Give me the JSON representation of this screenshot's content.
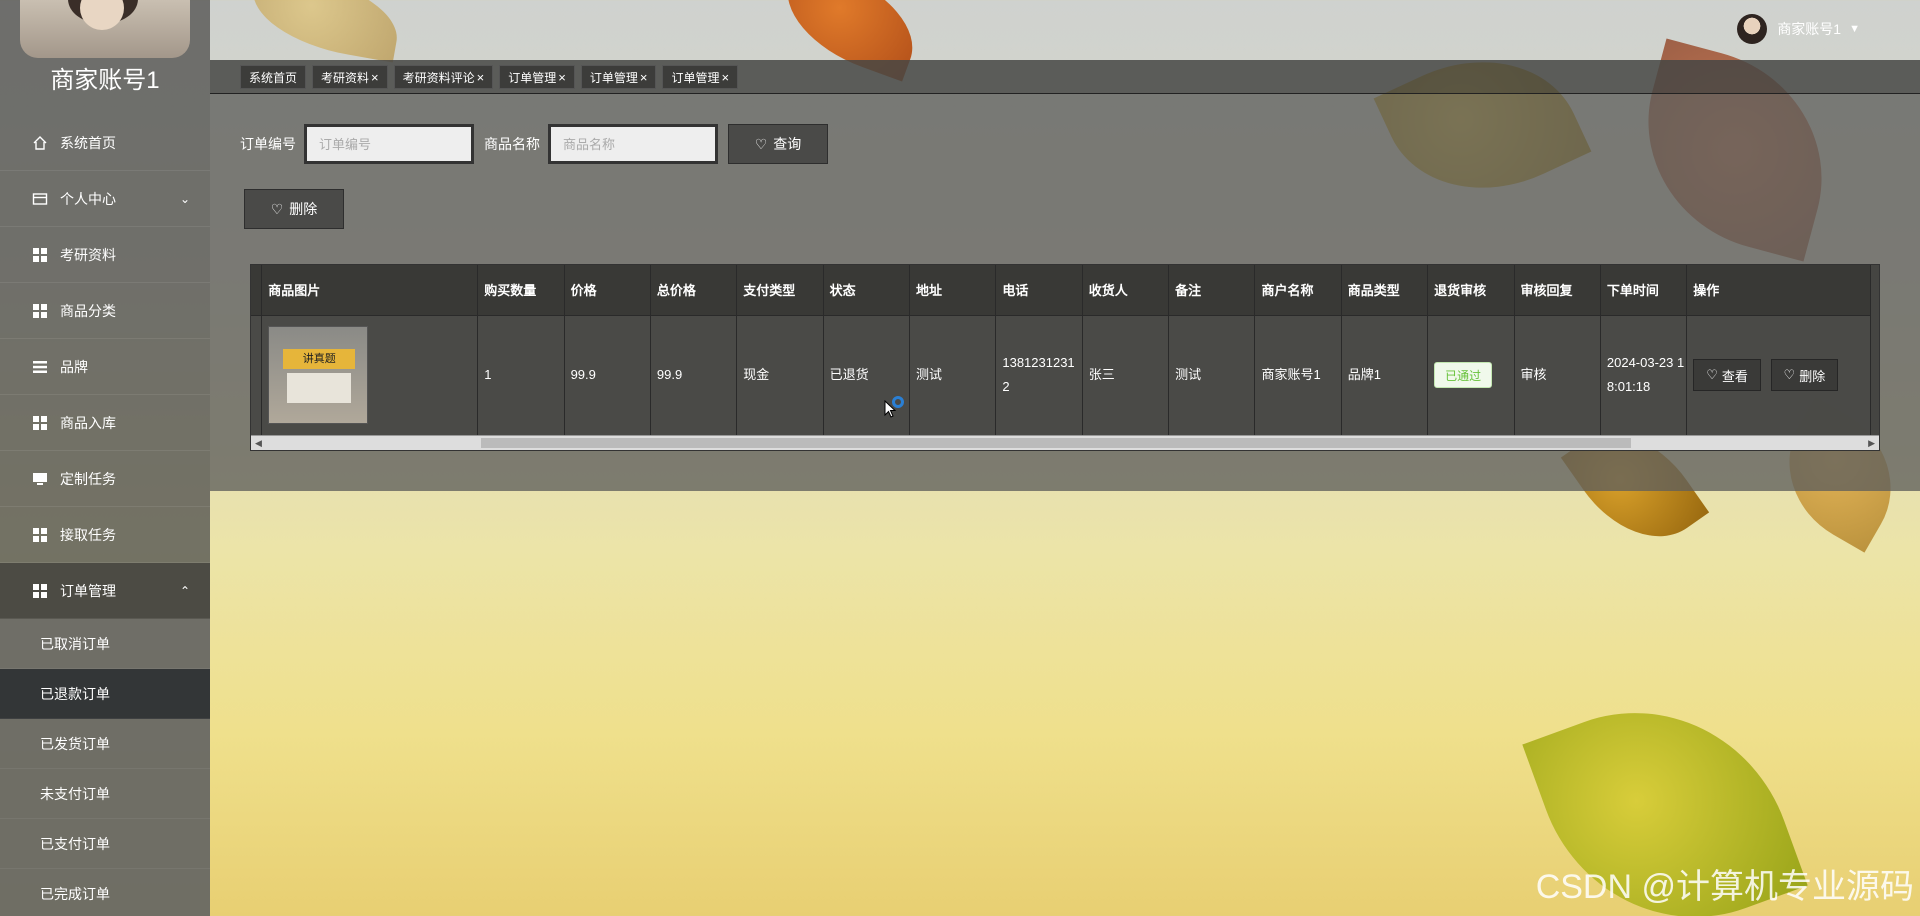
{
  "sidebar": {
    "title": "商家账号1",
    "items": [
      {
        "label": "系统首页",
        "icon": "home-icon"
      },
      {
        "label": "个人中心",
        "icon": "card-icon",
        "arrow": "chevron-down"
      },
      {
        "label": "考研资料",
        "icon": "grid-icon"
      },
      {
        "label": "商品分类",
        "icon": "grid-icon"
      },
      {
        "label": "品牌",
        "icon": "list-icon"
      },
      {
        "label": "商品入库",
        "icon": "grid-icon"
      },
      {
        "label": "定制任务",
        "icon": "monitor-icon"
      },
      {
        "label": "接取任务",
        "icon": "grid-icon"
      },
      {
        "label": "订单管理",
        "icon": "grid-icon",
        "arrow": "chevron-up"
      }
    ],
    "submenu": [
      "已取消订单",
      "已退款订单",
      "已发货订单",
      "未支付订单",
      "已支付订单",
      "已完成订单"
    ],
    "active_submenu": "已退款订单"
  },
  "header": {
    "username": "商家账号1"
  },
  "tabs": [
    {
      "label": "系统首页",
      "closable": false
    },
    {
      "label": "考研资料",
      "closable": true
    },
    {
      "label": "考研资料评论",
      "closable": true
    },
    {
      "label": "订单管理",
      "closable": true
    },
    {
      "label": "订单管理",
      "closable": true
    },
    {
      "label": "订单管理",
      "closable": true
    }
  ],
  "search": {
    "order_no_label": "订单编号",
    "order_no_placeholder": "订单编号",
    "product_name_label": "商品名称",
    "product_name_placeholder": "商品名称",
    "query_button": "查询",
    "delete_button": "删除"
  },
  "table": {
    "columns": [
      "商品图片",
      "购买数量",
      "价格",
      "总价格",
      "支付类型",
      "状态",
      "地址",
      "电话",
      "收货人",
      "备注",
      "商户名称",
      "商品类型",
      "退货审核",
      "审核回复",
      "下单时间",
      "操作"
    ],
    "rows": [
      {
        "image_text": "讲真题",
        "quantity": "1",
        "price": "99.9",
        "total": "99.9",
        "pay_type": "现金",
        "status": "已退货",
        "address": "测试",
        "phone": "13812312312",
        "receiver": "张三",
        "remark": "测试",
        "merchant": "商家账号1",
        "product_type": "品牌1",
        "return_review": "已通过",
        "review_reply": "审核",
        "order_time": "2024-03-23 18:01:18",
        "view_button": "查看",
        "delete_button": "删除"
      }
    ]
  },
  "watermark": "CSDN @计算机专业源码",
  "colors": {
    "accent_green": "#67c23a",
    "sidebar_bg": "#555552",
    "active_submenu_bg": "#282c30"
  }
}
